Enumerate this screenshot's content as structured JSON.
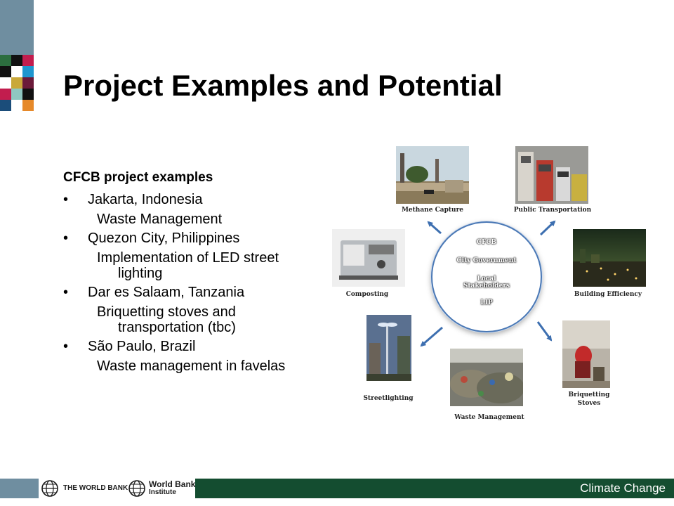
{
  "slide": {
    "title": "Project Examples and Potential"
  },
  "content": {
    "heading": "CFCB project examples",
    "bullet_char": "•",
    "items": [
      {
        "place": "Jakarta, Indonesia",
        "detail": "Waste Management"
      },
      {
        "place": "Quezon City, Philippines",
        "detail": "Implementation of LED street lighting"
      },
      {
        "place": "Dar es Salaam, Tanzania",
        "detail": "Briquetting stoves and transportation (tbc)"
      },
      {
        "place": "São Paulo, Brazil",
        "detail": "Waste management in favelas"
      }
    ]
  },
  "diagram": {
    "center": [
      "CFCB",
      "City Government",
      "Local Stakeholders",
      "LIP"
    ],
    "captions": {
      "methane": "Methane Capture",
      "transport": "Public Transportation",
      "building": "Building Efficiency",
      "composting": "Composting",
      "streetlighting": "Streetlighting",
      "waste": "Waste Management",
      "briquetting": "Briquetting Stoves"
    },
    "arrow_color": "#3d6fb0"
  },
  "footer": {
    "world_bank": "THE WORLD BANK",
    "wbi_line1": "World Bank",
    "wbi_line2": "Institute",
    "tagline": "Climate Change"
  },
  "colors": {
    "accent_slate": "#6f8ea0",
    "footer_green": "#144d30",
    "circle_border": "#4a78b5"
  }
}
